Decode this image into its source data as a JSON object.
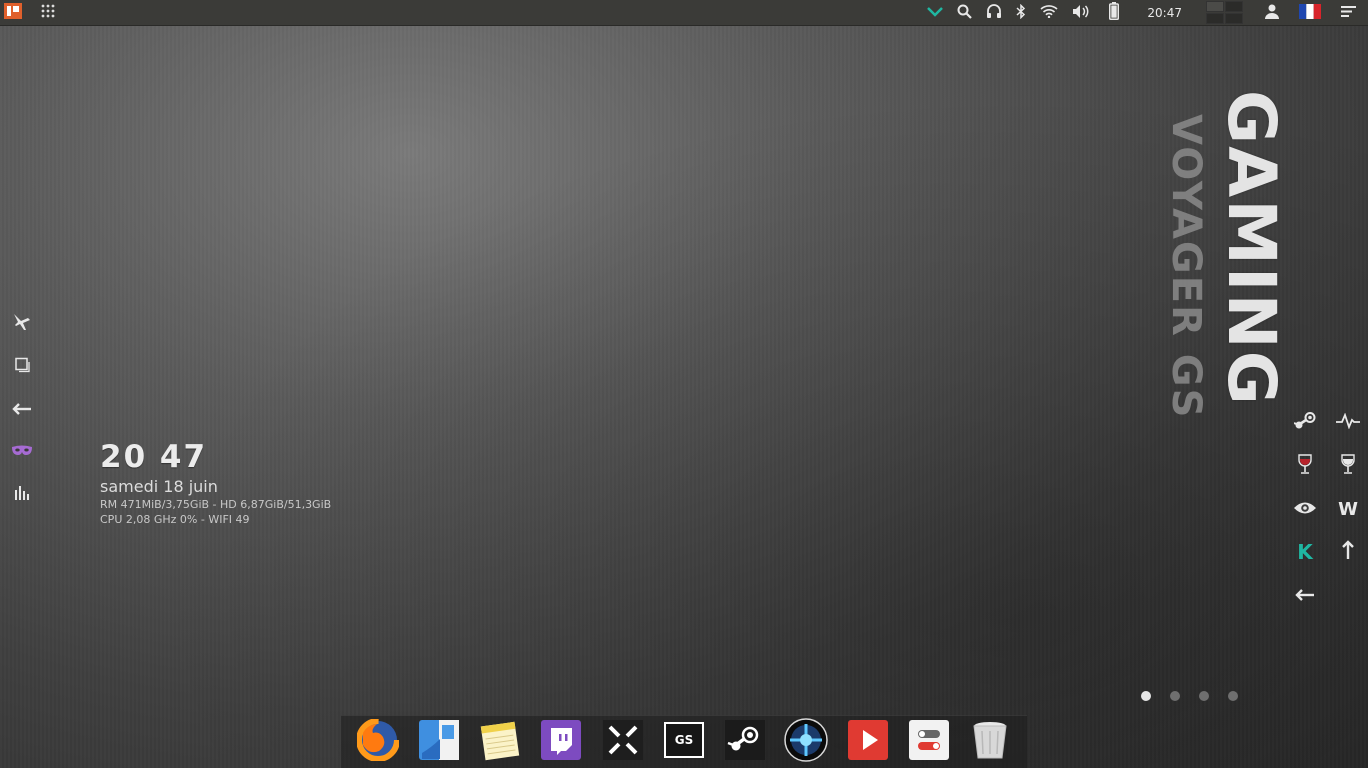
{
  "top_panel": {
    "apps_menu_icon": "app-menu-icon",
    "grid_icon": "apps-grid-icon",
    "indicators": [
      "chevron-down-icon",
      "search-icon",
      "headphones-icon",
      "bluetooth-icon",
      "wifi-icon",
      "volume-icon",
      "battery-icon"
    ],
    "clock": "20:47",
    "user_icon": "user-icon",
    "keyboard_layout_flag": "flag-fr-icon",
    "menu_icon": "panel-menu-icon"
  },
  "left_dock": [
    "airplane-icon",
    "window-icon",
    "arrow-left-icon",
    "mask-icon",
    "bar-chart-icon"
  ],
  "clock_widget": {
    "time": "20 47",
    "date": "samedi 18 juin",
    "memory_line": "RM 471MiB/3,75GiB - HD 6,87GiB/51,3GiB",
    "cpu_line": "CPU 2,08 GHz 0% - WIFI 49"
  },
  "branding": {
    "main": "GAMING",
    "sub": "VOYAGER GS"
  },
  "right_grid": {
    "items": [
      "steam-icon",
      "pulse-icon",
      "wine-icon",
      "wine-glass-icon",
      "eye-icon",
      "W",
      "K",
      "arrow-up-icon",
      "arrow-left-icon",
      ""
    ]
  },
  "page_dots": {
    "count": 4,
    "active": 0
  },
  "dock_apps": [
    "firefox",
    "finder",
    "notes",
    "twitch",
    "xbox-pad",
    "gamestats",
    "steam",
    "launcher",
    "video-player",
    "toggle-settings",
    "trash"
  ],
  "colors": {
    "panel_bg": "#3b3b38",
    "accent_teal": "#1fb7a2",
    "mask_purple": "#a66bd3"
  }
}
